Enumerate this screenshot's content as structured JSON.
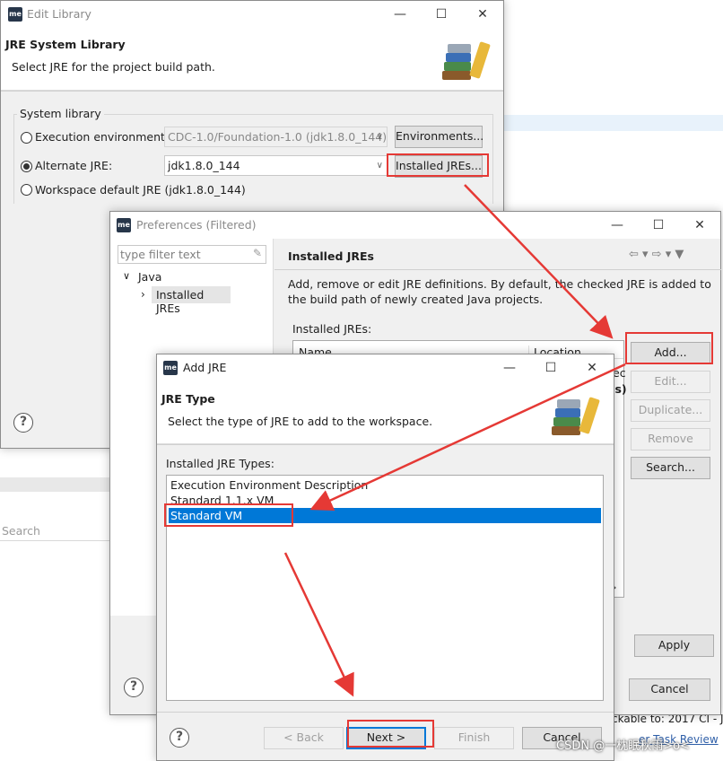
{
  "background": {
    "search_label": "Search",
    "status_text": "ckable to: 2017 CI - J",
    "link_text": "er  Task Review",
    "watermark": "CSDN @一枕眠秋雨>o<"
  },
  "edit_library": {
    "title": "Edit Library",
    "header_title": "JRE System Library",
    "header_desc": "Select JRE for the project build path.",
    "group_label": "System library",
    "exec_env_label": "Execution environment:",
    "exec_env_value": "CDC-1.0/Foundation-1.0 (jdk1.8.0_144)",
    "environments_button": "Environments...",
    "alternate_jre_label": "Alternate JRE:",
    "alternate_jre_value": "jdk1.8.0_144",
    "installed_jres_button": "Installed JREs...",
    "workspace_default_label": "Workspace default JRE (jdk1.8.0_144)",
    "help": "?"
  },
  "preferences": {
    "title": "Preferences (Filtered)",
    "filter_placeholder": "type filter text",
    "tree_root": "Java",
    "tree_child": "Installed JREs",
    "page_title": "Installed JREs",
    "description": "Add, remove or edit JRE definitions. By default, the checked JRE is added to the build path of newly created Java projects.",
    "installed_label": "Installed JREs:",
    "col_name": "Name",
    "col_location": "Location",
    "partial_row_1": "ec",
    "partial_row_2": "es)",
    "add_button": "Add...",
    "edit_button": "Edit...",
    "duplicate_button": "Duplicate...",
    "remove_button": "Remove",
    "search_button": "Search...",
    "apply_button": "Apply",
    "cancel_button": "Cancel",
    "help": "?"
  },
  "add_jre": {
    "title": "Add JRE",
    "header_title": "JRE Type",
    "header_desc": "Select the type of JRE to add to the workspace.",
    "list_label": "Installed JRE Types:",
    "types": [
      "Execution Environment Description",
      "Standard 1.1.x VM",
      "Standard VM"
    ],
    "selected_index": 2,
    "back_button": "< Back",
    "next_button": "Next >",
    "finish_button": "Finish",
    "cancel_button": "Cancel",
    "help": "?"
  },
  "colors": {
    "selection": "#0078d7",
    "annotation_red": "#e53935"
  }
}
